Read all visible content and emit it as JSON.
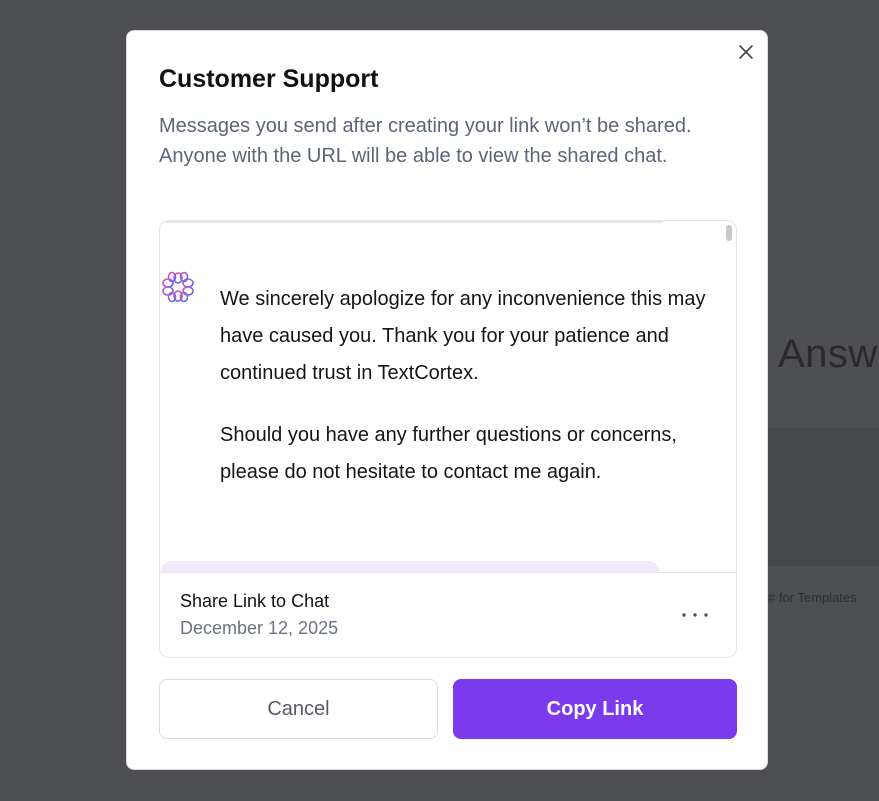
{
  "background": {
    "heading_fragment": "Answ",
    "hint_fragment": "# for Templates"
  },
  "modal": {
    "title": "Customer Support",
    "description": "Messages you send after creating your link won’t be shared. Anyone with the URL will be able to view the shared chat.",
    "close_icon": "close-icon"
  },
  "preview": {
    "assistant_icon": "flower-logo-icon",
    "messages": [
      "We sincerely apologize for any inconvenience this may have caused you. Thank you for your patience and continued trust in TextCortex.",
      "Should you have any further questions or concerns, please do not hesitate to contact me again."
    ],
    "share_title": "Share Link to Chat",
    "share_date": "December 12, 2025",
    "more_icon": "more-horizontal-icon"
  },
  "actions": {
    "cancel_label": "Cancel",
    "copy_label": "Copy Link"
  },
  "colors": {
    "accent": "#7c3aed",
    "overlay": "#4e4f52",
    "user_bubble": "#efe9fb"
  }
}
